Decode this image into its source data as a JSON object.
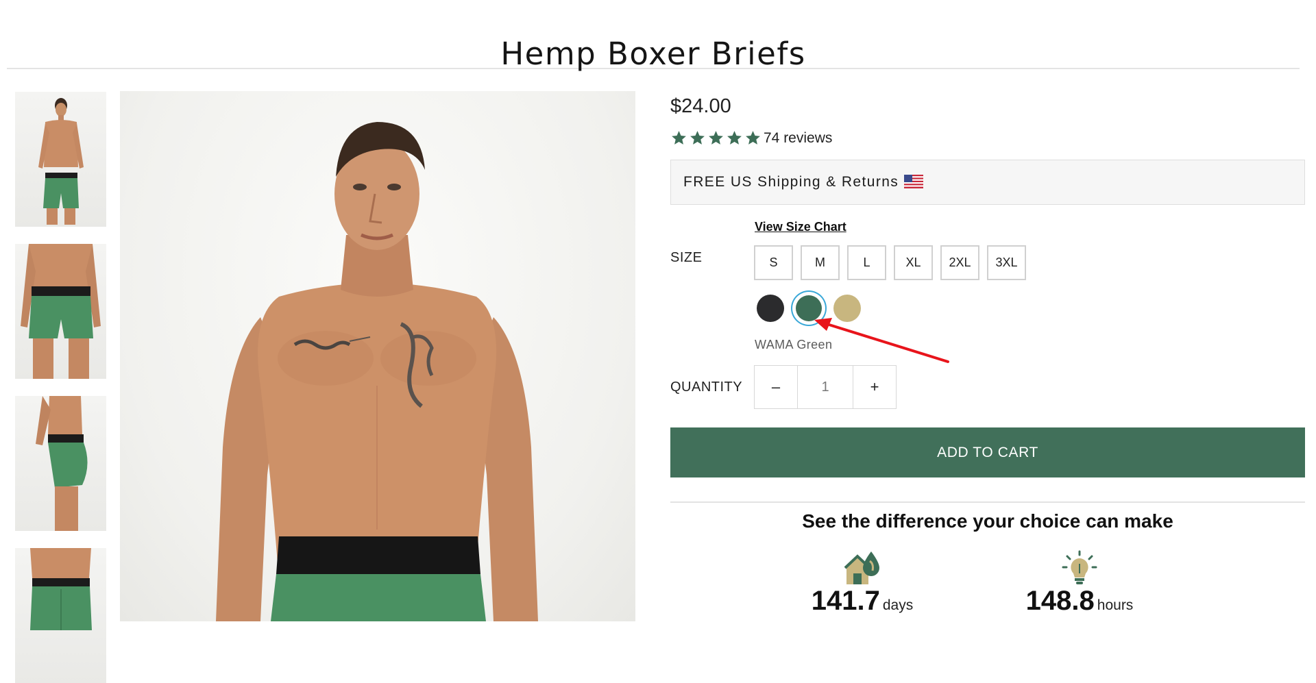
{
  "product": {
    "title": "Hemp Boxer Briefs"
  },
  "gallery": {
    "thumbnails": [
      "front-view",
      "front-detail",
      "side-view",
      "back-view"
    ],
    "main_image": "model-front-view"
  },
  "pricing": {
    "price": "$24.00"
  },
  "rating": {
    "stars": 5,
    "review_count_label": "74 reviews"
  },
  "shipping": {
    "text": "FREE US Shipping & Returns",
    "flag": "us-flag"
  },
  "size": {
    "chart_link": "View Size Chart",
    "label": "SIZE",
    "options": [
      "S",
      "M",
      "L",
      "XL",
      "2XL",
      "3XL"
    ]
  },
  "color": {
    "options": [
      {
        "name": "black",
        "hex": "#2b2b2d"
      },
      {
        "name": "green",
        "hex": "#3d6e57"
      },
      {
        "name": "tan",
        "hex": "#c8b67f"
      }
    ],
    "selected": "WAMA Green",
    "annotation_color": "#e8141b"
  },
  "quantity": {
    "label": "QUANTITY",
    "minus": "–",
    "plus": "+",
    "value": "1"
  },
  "cart": {
    "button_label": "ADD TO CART",
    "button_color": "#41705a"
  },
  "impact": {
    "heading": "See the difference your choice can make",
    "items": [
      {
        "icon": "water-drop-house-icon",
        "value": "141.7",
        "unit": "days"
      },
      {
        "icon": "lightbulb-icon",
        "value": "148.8",
        "unit": "hours"
      }
    ]
  },
  "colors": {
    "accent": "#41705a",
    "star": "#3d6e57",
    "selection_ring": "#3aa8d8"
  }
}
